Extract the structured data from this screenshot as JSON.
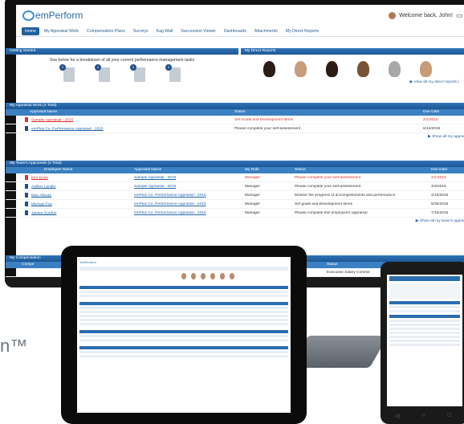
{
  "app": {
    "logo_text": "emPerform",
    "welcome_text": "Welcome back, John!"
  },
  "nav": {
    "tabs": [
      {
        "label": "Home"
      },
      {
        "label": "My Appraisal Work"
      },
      {
        "label": "Compensation Plans"
      },
      {
        "label": "Surveys"
      },
      {
        "label": "Kag Wall"
      },
      {
        "label": "Succession Viewer"
      },
      {
        "label": "Dashboards"
      },
      {
        "label": "Attachments"
      },
      {
        "label": "My Direct Reports"
      }
    ]
  },
  "getting_started": {
    "header": "Getting Started",
    "text": "See below for a breakdown of all your current performance management tasks",
    "badges": [
      "1",
      "1",
      "1",
      "1"
    ]
  },
  "direct_reports": {
    "header": "My Direct Reports",
    "view_all": "▶ View all my direct reports (",
    "faces": [
      "person",
      "person",
      "person",
      "person",
      "person",
      "person"
    ]
  },
  "appraisal_work": {
    "header": "My Appraisal Work (2 Total)",
    "columns": [
      "Appraisal Name",
      "Status",
      "Due Date"
    ],
    "rows": [
      {
        "name": "Sample Appraisal - 2015",
        "status": "Set Goals and Development Items",
        "due": "2/1/2015"
      },
      {
        "name": "emPlus Co. Performance Appraisal - 2015",
        "status": "Please complete your self-assessment",
        "due": "6/14/2015"
      }
    ],
    "show_all": "▶ Show all my apprais"
  },
  "team_appraisals": {
    "header": "My Team's Appraisals (5 Total)",
    "columns": [
      "Employee Name",
      "Appraisal Name",
      "My Role",
      "Status",
      "Due Date"
    ],
    "rows": [
      {
        "employee": "Kim Dunn",
        "appraisal": "Sample Appraisal - 2015",
        "role": "Manager",
        "status": "Please complete your self-assessment",
        "due": "2/1/2015"
      },
      {
        "employee": "Ashley Landry",
        "appraisal": "Sample Appraisal - 2015",
        "role": "Manager",
        "status": "Please complete your self-assessment",
        "due": "3/3/2015"
      },
      {
        "employee": "Max Allergo",
        "appraisal": "emPlus Co. Performance Appraisal - 2015",
        "role": "Manager",
        "status": "Monitor the progress of accomplishments and performance",
        "due": "4/16/2015"
      },
      {
        "employee": "Michael Fox",
        "appraisal": "emPlus Co. Performance Appraisal - 2015",
        "role": "Manager",
        "status": "Set goals and Development Items",
        "due": "5/25/2016"
      },
      {
        "employee": "James Gordon",
        "appraisal": "emPlus Co. Performance Appraisal - 2015",
        "role": "Manager",
        "status": "Please complete this employee's appraisal",
        "due": "7/16/2016"
      }
    ],
    "show_all": "▶ Show all my team's apprais"
  },
  "comp_panel": {
    "header": "My Compensation",
    "columns": [
      "Compe",
      "Status"
    ],
    "first_status": "Executive Salary Comme"
  },
  "brand_fragment": "n™",
  "colors": {
    "accent": "#1f5f9e",
    "red": "#dd3333"
  }
}
